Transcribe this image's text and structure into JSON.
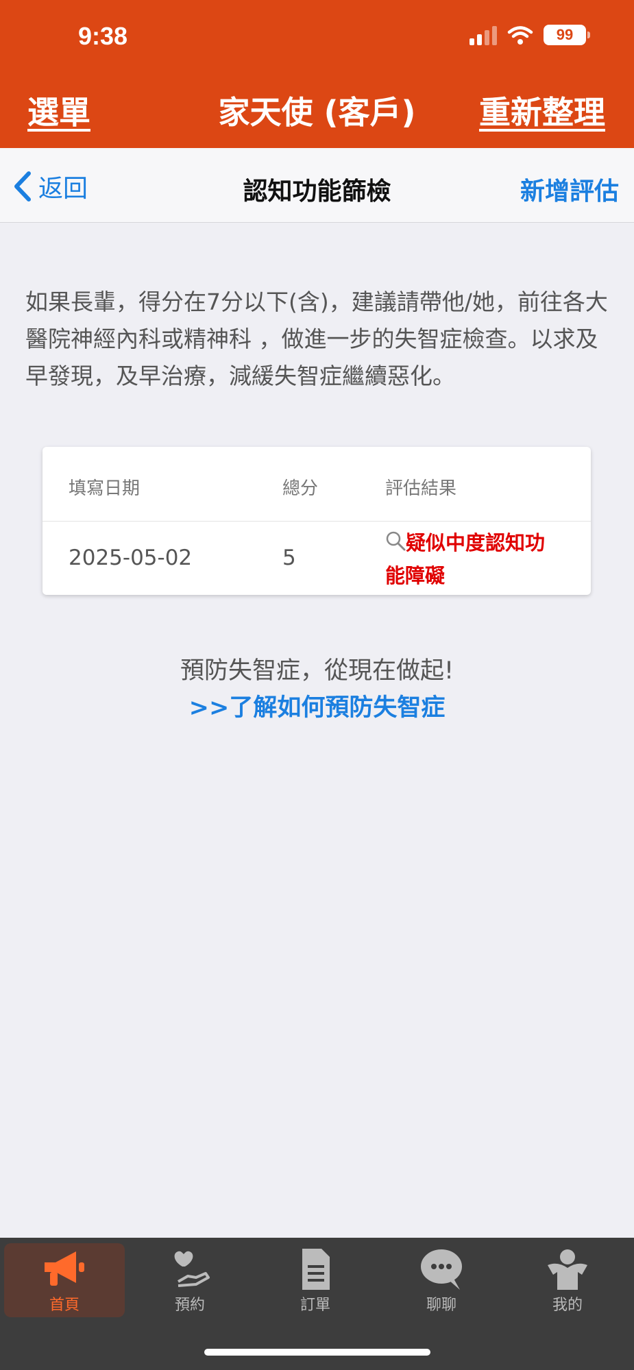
{
  "status_bar": {
    "time": "9:38",
    "battery": "99"
  },
  "nav": {
    "left": "選單",
    "title": "家天使 (客戶)",
    "right": "重新整理"
  },
  "subbar": {
    "back_label": "返回",
    "title": "認知功能篩檢",
    "action": "新增評估"
  },
  "notice": "如果長輩，得分在7分以下(含)，建議請帶他/她，前往各大醫院神經內科或精神科 ，做進一步的失智症檢查。以求及早發現，及早治療，減緩失智症繼續惡化。",
  "table": {
    "headers": {
      "date": "填寫日期",
      "score": "總分",
      "result": "評估結果"
    },
    "rows": [
      {
        "date": "2025-05-02",
        "score": "5",
        "result": "疑似中度認知功能障礙"
      }
    ]
  },
  "prevent": {
    "text": "預防失智症，從現在做起!",
    "link": ">>了解如何預防失智症"
  },
  "tabs": [
    {
      "label": "首頁",
      "icon": "megaphone-icon",
      "active": true
    },
    {
      "label": "預約",
      "icon": "heart-hand-icon",
      "active": false
    },
    {
      "label": "訂單",
      "icon": "document-icon",
      "active": false
    },
    {
      "label": "聊聊",
      "icon": "chat-bubble-icon",
      "active": false
    },
    {
      "label": "我的",
      "icon": "angel-icon",
      "active": false
    }
  ],
  "colors": {
    "brand": "#dc4714",
    "link": "#1b7fe0",
    "alert": "#e00000",
    "tab_active": "#ff6a2b"
  }
}
